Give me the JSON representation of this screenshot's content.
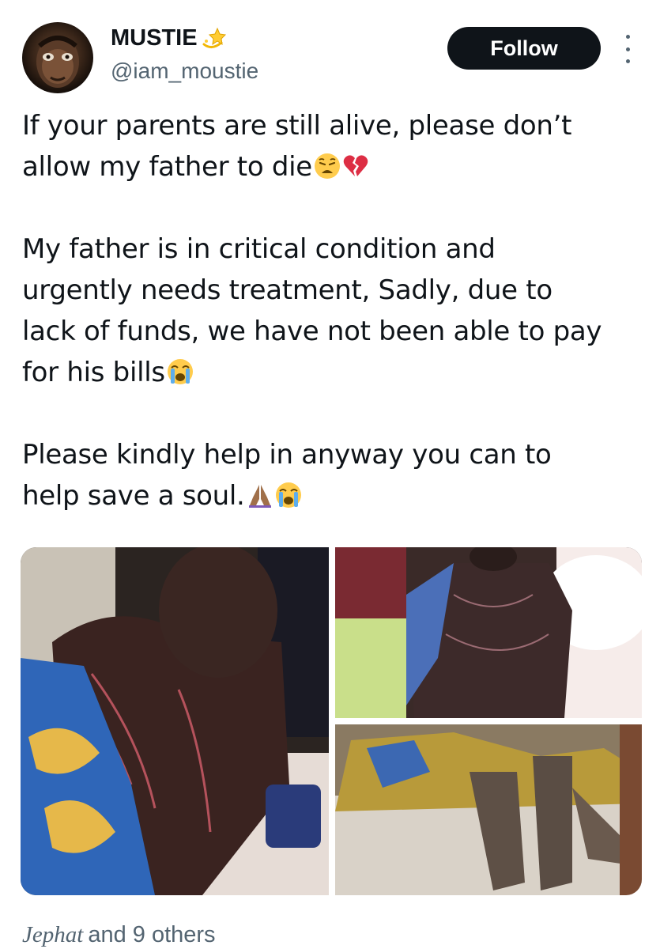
{
  "header": {
    "display_name": "MUSTIE",
    "name_badge_icon": "dizzy-star-icon",
    "handle": "@iam_moustie",
    "follow_label": "Follow",
    "more_icon": "more-vertical-icon"
  },
  "tweet": {
    "paragraphs": [
      {
        "lines": [
          "If your parents are still alive, please don’t",
          "allow my father to die"
        ],
        "trailing_emoji": [
          "weary-face-icon",
          "broken-heart-icon"
        ]
      },
      {
        "lines": [
          "My father is in critical condition and",
          "urgently needs treatment,  Sadly, due to",
          "lack of funds, we have not been able to pay",
          "for his bills"
        ],
        "trailing_emoji": [
          "loudly-crying-face-icon"
        ]
      },
      {
        "lines": [
          "Please kindly help in anyway you can to",
          "help save a soul."
        ],
        "trailing_emoji": [
          "folded-hands-icon",
          "loudly-crying-face-icon"
        ]
      }
    ]
  },
  "media": {
    "count": 3
  },
  "engagement": {
    "liker_name": "Jephat",
    "others_text": "and 9 others"
  },
  "colors": {
    "text_primary": "#0f1419",
    "text_secondary": "#536471",
    "button_bg": "#0f1419",
    "button_text": "#ffffff"
  }
}
